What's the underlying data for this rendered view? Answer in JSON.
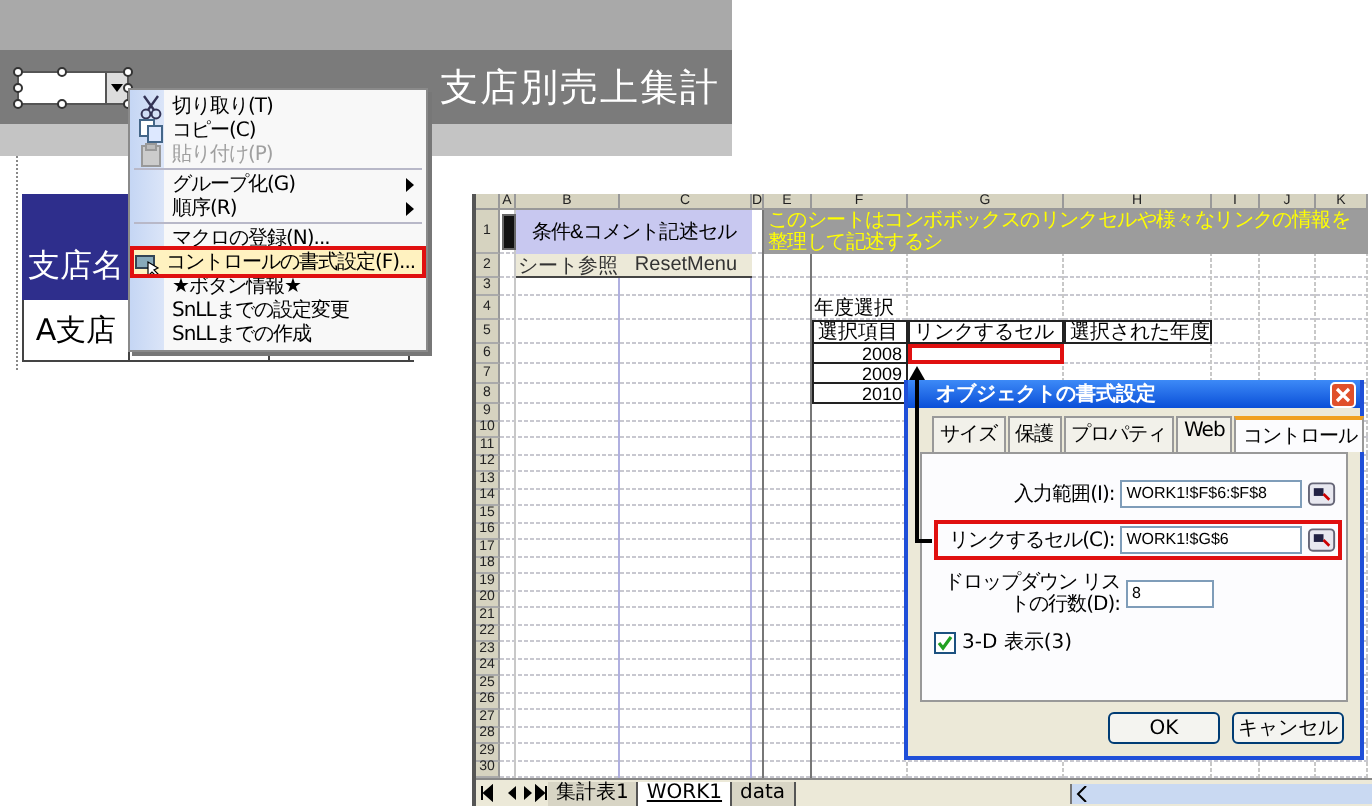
{
  "back_window": {
    "title": "支店別売上集計",
    "table": {
      "header": "支店名",
      "rows": [
        "A支店"
      ]
    },
    "context_menu": [
      {
        "label": "切り取り(T)",
        "kind": "cut",
        "disabled": false,
        "submenu": false,
        "highlighted": false,
        "separator_before": false
      },
      {
        "label": "コピー(C)",
        "kind": "copy",
        "disabled": false,
        "submenu": false,
        "highlighted": false,
        "separator_before": false
      },
      {
        "label": "貼り付け(P)",
        "kind": "paste",
        "disabled": true,
        "submenu": false,
        "highlighted": false,
        "separator_before": false
      },
      {
        "label": "グループ化(G)",
        "kind": "plain",
        "disabled": false,
        "submenu": true,
        "highlighted": false,
        "separator_before": true
      },
      {
        "label": "順序(R)",
        "kind": "plain",
        "disabled": false,
        "submenu": true,
        "highlighted": false,
        "separator_before": false
      },
      {
        "label": "マクロの登録(N)...",
        "kind": "plain",
        "disabled": false,
        "submenu": false,
        "highlighted": false,
        "separator_before": true
      },
      {
        "label": "コントロールの書式設定(F)...",
        "kind": "format",
        "disabled": false,
        "submenu": false,
        "highlighted": true,
        "separator_before": false
      },
      {
        "label": "★ボタン情報★",
        "kind": "plain",
        "disabled": false,
        "submenu": false,
        "highlighted": false,
        "separator_before": false
      },
      {
        "label": "SnLLまでの設定変更",
        "kind": "plain",
        "disabled": false,
        "submenu": false,
        "highlighted": false,
        "separator_before": false
      },
      {
        "label": "SnLLまでの作成",
        "kind": "plain",
        "disabled": false,
        "submenu": false,
        "highlighted": false,
        "separator_before": false
      }
    ]
  },
  "sheet": {
    "columns": [
      "A",
      "B",
      "C",
      "D",
      "E",
      "F",
      "G",
      "H",
      "I",
      "J",
      "K"
    ],
    "rows": [
      {
        "number": "1",
        "cells": {
          "A": {
            "kind": "button"
          },
          "B:C": {
            "kind": "note",
            "text": "条件&コメント記述セル"
          },
          "E:K": {
            "kind": "banner",
            "text": "このシートはコンボボックスのリンクセルや様々なリンクの情報を整理して記述するシ"
          }
        }
      },
      {
        "number": "2",
        "cells": {
          "B": {
            "kind": "label",
            "text": "シート参照"
          },
          "C": {
            "kind": "label",
            "text": "ResetMenu"
          }
        }
      },
      {
        "number": "3"
      },
      {
        "number": "4",
        "cells": {
          "F": {
            "kind": "plain",
            "text": "年度選択"
          }
        }
      },
      {
        "number": "5",
        "cells": {
          "F": {
            "kind": "header",
            "text": "選択項目"
          },
          "G": {
            "kind": "header",
            "text": "リンクするセル"
          },
          "H": {
            "kind": "header",
            "text": "選択された年度"
          }
        }
      },
      {
        "number": "6",
        "cells": {
          "F": {
            "kind": "year",
            "text": "2008"
          },
          "G": {
            "kind": "link"
          }
        }
      },
      {
        "number": "7",
        "cells": {
          "F": {
            "kind": "year",
            "text": "2009"
          }
        }
      },
      {
        "number": "8",
        "cells": {
          "F": {
            "kind": "year",
            "text": "2010"
          }
        }
      },
      {
        "number": "9"
      },
      {
        "number": "10"
      },
      {
        "number": "11"
      },
      {
        "number": "12"
      },
      {
        "number": "13"
      },
      {
        "number": "14"
      },
      {
        "number": "15"
      },
      {
        "number": "16"
      },
      {
        "number": "17"
      },
      {
        "number": "18"
      },
      {
        "number": "19"
      },
      {
        "number": "20"
      },
      {
        "number": "21"
      },
      {
        "number": "22"
      },
      {
        "number": "23"
      },
      {
        "number": "24"
      },
      {
        "number": "25"
      },
      {
        "number": "26"
      },
      {
        "number": "27"
      },
      {
        "number": "28"
      },
      {
        "number": "29"
      },
      {
        "number": "30"
      }
    ],
    "tabs": [
      {
        "label": "集計表1",
        "selected": false
      },
      {
        "label": "WORK1",
        "selected": true
      },
      {
        "label": "data",
        "selected": false
      }
    ]
  },
  "dialog": {
    "title": "オブジェクトの書式設定",
    "tabs": [
      {
        "label": "サイズ",
        "selected": false
      },
      {
        "label": "保護",
        "selected": false
      },
      {
        "label": "プロパティ",
        "selected": false
      },
      {
        "label": "Web",
        "selected": false
      },
      {
        "label": "コントロール",
        "selected": true
      }
    ],
    "fields": [
      {
        "label": "入力範囲(I):",
        "value": "WORK1!$F$6:$F$8",
        "kind": "range",
        "highlighted": false
      },
      {
        "label": "リンクするセル(C):",
        "value": "WORK1!$G$6",
        "kind": "range",
        "highlighted": true
      },
      {
        "label": "ドロップダウン リストの行数(D):",
        "value": "8",
        "kind": "number",
        "highlighted": false
      }
    ],
    "checkbox": {
      "label": "3-D 表示(3)",
      "checked": true
    },
    "buttons": [
      "OK",
      "キャンセル"
    ]
  }
}
